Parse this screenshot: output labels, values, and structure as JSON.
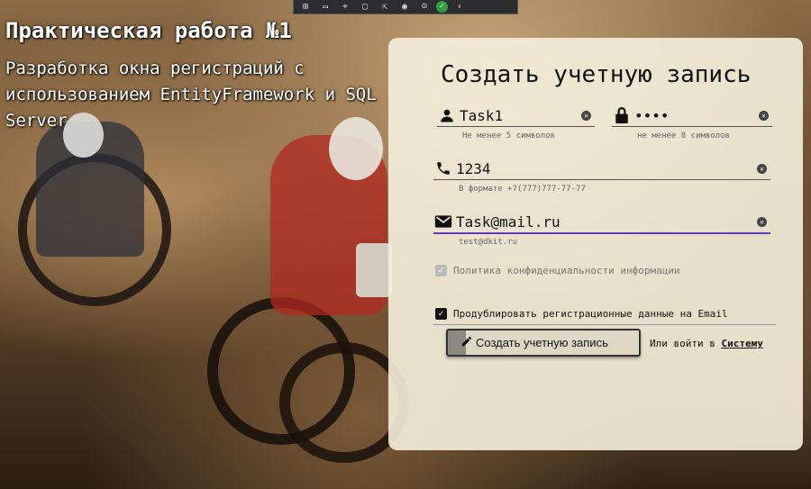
{
  "devbar": {
    "icons": [
      "⊞",
      "▭",
      "⌖",
      "▢",
      "⇱",
      "◉",
      "☺",
      "✓",
      "‹"
    ]
  },
  "header": {
    "title": "Практическая работа №1",
    "subtitle": "Разработка окна регистраций с использованием EntityFramework и SQL Server"
  },
  "form": {
    "title": "Создать учетную запись",
    "login": {
      "value": "Task1",
      "hint": "Не менее 5 символов",
      "icon": "person-icon"
    },
    "password": {
      "value": "••••",
      "hint": "не менее 8 символов",
      "icon": "lock-icon"
    },
    "phone": {
      "value": "1234",
      "hint": "В формате +7(777)777-77-77",
      "icon": "phone-icon"
    },
    "email": {
      "value": "Task@mail.ru",
      "hint": "test@dkit.ru",
      "icon": "mail-icon"
    },
    "privacy_label": "Политика конфиденциальности информации",
    "privacy_checked": true,
    "duplicate_label": "Продублировать регистрационные данные на Email",
    "duplicate_checked": true,
    "submit_label": "Создать учетную запись",
    "login_prompt": "Или войти в",
    "login_link": "Систему",
    "accent_color": "#673ab7"
  }
}
